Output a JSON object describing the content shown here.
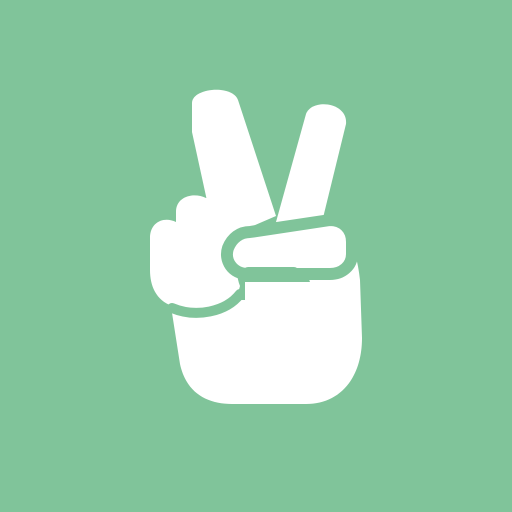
{
  "app_icon": {
    "icon": "peace-hand-icon",
    "background_color": "#80C49A",
    "foreground_color": "#FFFFFF"
  }
}
